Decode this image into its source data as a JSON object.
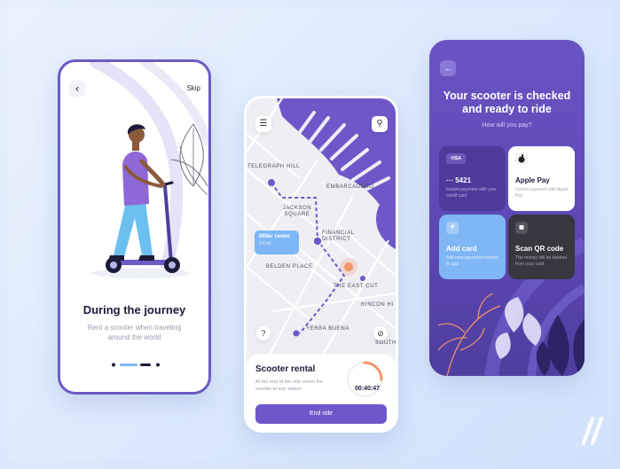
{
  "onboarding": {
    "back_icon": "chevron-left-icon",
    "skip_label": "Skip",
    "title": "During the journey",
    "subtitle": "Rent a scooter when traveling around the world",
    "pager": {
      "pages": 4,
      "active": 2
    }
  },
  "map_screen": {
    "menu_icon": "hamburger-menu-icon",
    "search_icon": "search-icon",
    "streets": [
      "TELEGRAPH HILL",
      "EMBARCADERO",
      "JACKSON SQUARE",
      "FINANCIAL DISTRICT",
      "BELDEN PLACE",
      "THE EAST CUT",
      "RINCON HI",
      "YERBA BUENA",
      "SOUTH"
    ],
    "bubble": {
      "title": "Miller center",
      "distance": "0.6 mi"
    },
    "help_icon": "question-icon",
    "compass_icon": "compass-icon",
    "rental": {
      "title": "Scooter rental",
      "description": "At the end of the ride return the scooter to any station",
      "timer": "00:40:47",
      "end_button": "End ride"
    }
  },
  "payment": {
    "back_icon": "arrow-left-icon",
    "title": "Your scooter is checked and ready to ride",
    "subtitle": "How will you pay?",
    "options": [
      {
        "icon": "VISA",
        "title": "··· 5421",
        "desc": "Instant payment with your credit card"
      },
      {
        "icon": "apple-icon",
        "title": "Apple Pay",
        "desc": "Instant payment with Apple Pay"
      },
      {
        "icon": "+",
        "title": "Add card",
        "desc": "Add new payment method to app"
      },
      {
        "icon": "qr-icon",
        "title": "Scan QR code",
        "desc": "The money will be debited from your card"
      }
    ]
  },
  "colors": {
    "accent": "#6b5bc4",
    "light_blue": "#7fb6f5",
    "route": "#6f57c9",
    "pin": "#f4956a"
  }
}
